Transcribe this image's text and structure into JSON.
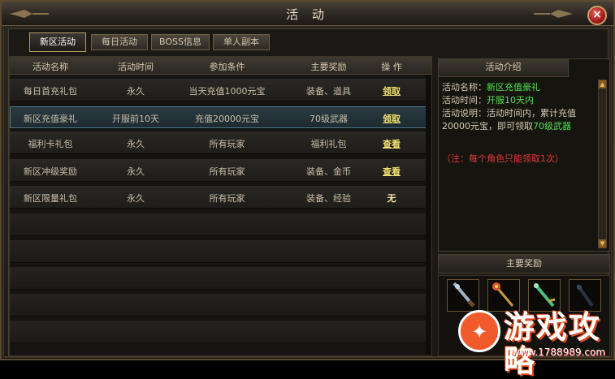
{
  "window": {
    "title": "活  动",
    "close_icon": "×"
  },
  "tabs": [
    {
      "label": "新区活动",
      "active": true
    },
    {
      "label": "每日活动",
      "active": false
    },
    {
      "label": "BOSS信息",
      "active": false
    },
    {
      "label": "单人副本",
      "active": false
    }
  ],
  "table": {
    "headers": [
      "活动名称",
      "活动时间",
      "参加条件",
      "主要奖励",
      "操   作"
    ],
    "rows": [
      {
        "name": "每日首充礼包",
        "time": "永久",
        "condition": "当天充值1000元宝",
        "reward": "装备、道具",
        "action": "领取"
      },
      {
        "name": "新区充值豪礼",
        "time": "开服前10天",
        "condition": "充值20000元宝",
        "reward": "70级武器",
        "action": "领取"
      },
      {
        "name": "福利卡礼包",
        "time": "永久",
        "condition": "所有玩家",
        "reward": "福利礼包",
        "action": "查看"
      },
      {
        "name": "新区冲级奖励",
        "time": "永久",
        "condition": "所有玩家",
        "reward": "装备、金币",
        "action": "查看"
      },
      {
        "name": "新区限量礼包",
        "time": "永久",
        "condition": "所有玩家",
        "reward": "装备、经验",
        "action": "无"
      }
    ]
  },
  "intro": {
    "tab_label": "活动介绍",
    "name_key": "活动名称：",
    "name_value": "新区充值豪礼",
    "time_key": "活动时间：",
    "time_value": "开服10天内",
    "desc_key": "活动说明：活动时间内，累计充值20000元宝，即可领取",
    "desc_value": "70级武器",
    "note": "（注：每个角色只能领取1次）"
  },
  "rewards": {
    "header": "主要奖励"
  },
  "watermark": {
    "text": "游戏攻略",
    "url": "www.1788989.com"
  },
  "colors": {
    "highlight_green": "#53e053",
    "note_red": "#e03a3a",
    "link_yellow": "#f0e070",
    "selected_row": "#2b3a42"
  }
}
